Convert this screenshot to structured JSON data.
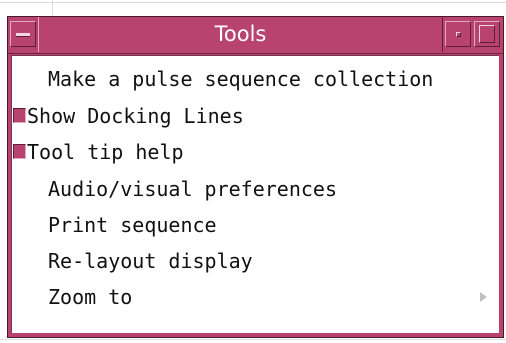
{
  "window": {
    "title": "Tools"
  },
  "menu": {
    "items": [
      {
        "label": "Make a pulse sequence collection",
        "type": "command"
      },
      {
        "label": "Show Docking Lines",
        "type": "check",
        "checked": true
      },
      {
        "label": "Tool tip help",
        "type": "check",
        "checked": true
      },
      {
        "label": "Audio/visual preferences",
        "type": "command"
      },
      {
        "label": "Print sequence",
        "type": "command"
      },
      {
        "label": "Re-layout display",
        "type": "command"
      },
      {
        "label": "Zoom to",
        "type": "cascade",
        "icon": "submenu-arrow-icon"
      }
    ]
  },
  "colors": {
    "accent": "#b8436f",
    "menu_background": "#ffffff",
    "text": "#111111"
  }
}
